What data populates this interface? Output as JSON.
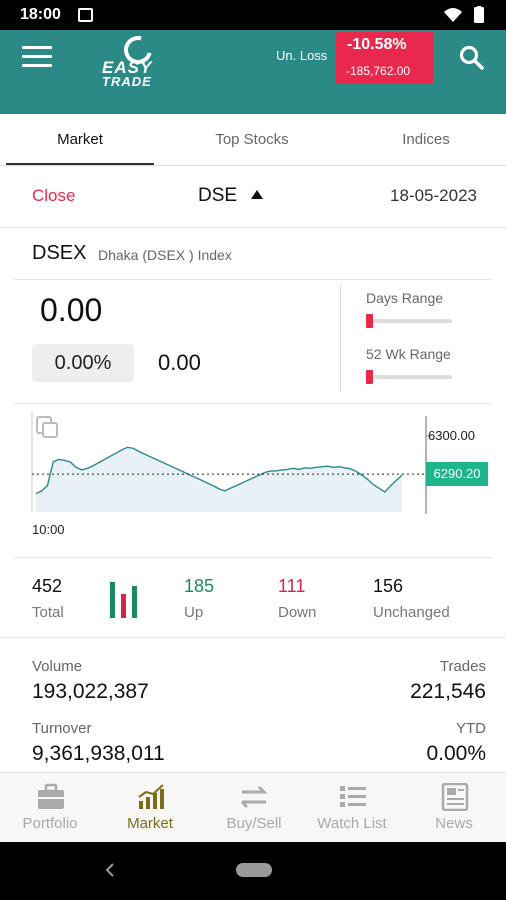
{
  "status_bar": {
    "time": "18:00"
  },
  "app_bar": {
    "logo_line1": "EASY",
    "logo_line2": "TRADE",
    "unrealized_label": "Un. Loss",
    "unrealized_pct": "-10.58%",
    "unrealized_value": "-185,762.00"
  },
  "tabs": [
    {
      "label": "Market",
      "active": true
    },
    {
      "label": "Top Stocks",
      "active": false
    },
    {
      "label": "Indices",
      "active": false
    }
  ],
  "market": {
    "status": "Close",
    "exchange": "DSE",
    "date": "18-05-2023"
  },
  "index": {
    "name": "DSEX",
    "description": "Dhaka (DSEX ) Index",
    "value": "0.00",
    "change_pct": "0.00%",
    "change": "0.00",
    "days_range_label": "Days Range",
    "wk52_range_label": "52 Wk Range",
    "days_range_level": 0.0,
    "wk52_range_level": 0.0
  },
  "chart": {
    "start_time_label": "10:00",
    "upper_label": "6300.00",
    "current_label": "6290.20",
    "colors": {
      "line": "#2b8a86",
      "fill": "#e8f1f8",
      "tag": "#1fb58a"
    }
  },
  "chart_data": {
    "type": "area",
    "x_start": "10:00",
    "y_ticks": [
      "6300.00"
    ],
    "current_value": 6290.2,
    "y_range": [
      6283,
      6302
    ],
    "series": [
      {
        "values": [
          6286.5,
          6287.0,
          6288.0,
          6292.5,
          6293.0,
          6292.8,
          6292.5,
          6291.5,
          6291.0,
          6291.3,
          6291.8,
          6292.4,
          6293.0,
          6293.6,
          6294.2,
          6294.8,
          6295.3,
          6295.1,
          6294.5,
          6294.0,
          6293.5,
          6293.0,
          6292.5,
          6292.0,
          6291.5,
          6291.0,
          6290.5,
          6290.0,
          6289.5,
          6289.0,
          6288.5,
          6288.0,
          6287.4,
          6287.0,
          6287.5,
          6288.0,
          6288.5,
          6289.0,
          6289.5,
          6290.0,
          6290.5,
          6290.8,
          6290.8,
          6291.0,
          6291.1,
          6291.3,
          6291.1,
          6291.4,
          6291.3,
          6291.5,
          6291.6,
          6291.7,
          6291.5,
          6291.6,
          6291.4,
          6291.2,
          6290.7,
          6290.0,
          6289.2,
          6288.2,
          6287.5,
          6286.8,
          6288.0,
          6289.0,
          6290.0
        ]
      }
    ]
  },
  "stats": {
    "total_value": "452",
    "total_label": "Total",
    "up_value": "185",
    "up_label": "Up",
    "down_value": "111",
    "down_label": "Down",
    "unchanged_value": "156",
    "unchanged_label": "Unchanged"
  },
  "volume": {
    "volume_label": "Volume",
    "volume_value": "193,022,387",
    "trades_label": "Trades",
    "trades_value": "221,546",
    "turnover_label": "Turnover",
    "turnover_value": "9,361,938,011",
    "ytd_label": "YTD",
    "ytd_value": "0.00%"
  },
  "bottom_nav": [
    {
      "label": "Portfolio",
      "icon": "briefcase-icon",
      "active": false
    },
    {
      "label": "Market",
      "icon": "bar-chart-icon",
      "active": true
    },
    {
      "label": "Buy/Sell",
      "icon": "swap-arrows-icon",
      "active": false
    },
    {
      "label": "Watch List",
      "icon": "list-icon",
      "active": false
    },
    {
      "label": "News",
      "icon": "newspaper-icon",
      "active": false
    }
  ],
  "accent_colors": {
    "teal": "#2b8a86",
    "loss_red": "#e8294d",
    "up_green": "#1a8a63",
    "nav_active": "#7d6d18"
  }
}
